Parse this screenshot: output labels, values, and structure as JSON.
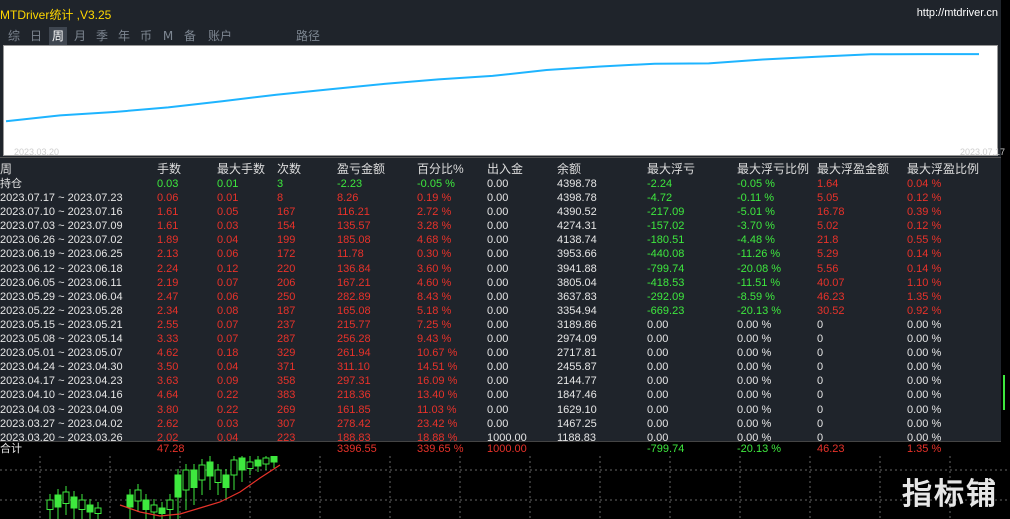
{
  "window": {
    "title": "MTDriver统计 ,V3.25",
    "site": "http://mtdriver.cn"
  },
  "tabs": [
    "综",
    "日",
    "周",
    "月",
    "季",
    "年",
    "币",
    "M",
    "备",
    "账户",
    "路径"
  ],
  "active_tab": "周",
  "curve": {
    "start_date": "2023.03.20",
    "end_date": "2023.07.17",
    "line_color": "#1eb4ff",
    "balances": [
      1188.83,
      1467.25,
      1629.1,
      1847.46,
      2144.77,
      2455.87,
      2717.81,
      2974.09,
      3189.86,
      3354.94,
      3637.83,
      3805.04,
      3941.88,
      3953.66,
      4138.74,
      4274.31,
      4390.52,
      4398.78,
      4398.78
    ]
  },
  "columns": [
    "周",
    "手数",
    "最大手数",
    "次数",
    "盈亏金额",
    "百分比%",
    "出入金",
    "余额",
    "最大浮亏",
    "最大浮亏比例",
    "最大浮盈金额",
    "最大浮盈比例"
  ],
  "holding": {
    "label": "持仓",
    "lots": "0.03",
    "max_lots": "0.01",
    "count": "3",
    "pnl": "-2.23",
    "pct": "-0.05 %",
    "deposit": "0.00",
    "balance": "4398.78",
    "max_dd": "-2.24",
    "max_dd_pct": "-0.05 %",
    "max_fp": "1.64",
    "max_fp_pct": "0.04 %"
  },
  "rows": [
    {
      "week": "2023.07.17 ~ 2023.07.23",
      "lots": "0.06",
      "max_lots": "0.01",
      "count": "8",
      "pnl": "8.26",
      "pct": "0.19 %",
      "deposit": "0.00",
      "balance": "4398.78",
      "max_dd": "-4.72",
      "max_dd_pct": "-0.11 %",
      "max_fp": "5.05",
      "max_fp_pct": "0.12 %"
    },
    {
      "week": "2023.07.10 ~ 2023.07.16",
      "lots": "1.61",
      "max_lots": "0.05",
      "count": "167",
      "pnl": "116.21",
      "pct": "2.72 %",
      "deposit": "0.00",
      "balance": "4390.52",
      "max_dd": "-217.09",
      "max_dd_pct": "-5.01 %",
      "max_fp": "16.78",
      "max_fp_pct": "0.39 %"
    },
    {
      "week": "2023.07.03 ~ 2023.07.09",
      "lots": "1.61",
      "max_lots": "0.03",
      "count": "154",
      "pnl": "135.57",
      "pct": "3.28 %",
      "deposit": "0.00",
      "balance": "4274.31",
      "max_dd": "-157.02",
      "max_dd_pct": "-3.70 %",
      "max_fp": "5.02",
      "max_fp_pct": "0.12 %"
    },
    {
      "week": "2023.06.26 ~ 2023.07.02",
      "lots": "1.89",
      "max_lots": "0.04",
      "count": "199",
      "pnl": "185.08",
      "pct": "4.68 %",
      "deposit": "0.00",
      "balance": "4138.74",
      "max_dd": "-180.51",
      "max_dd_pct": "-4.48 %",
      "max_fp": "21.8",
      "max_fp_pct": "0.55 %"
    },
    {
      "week": "2023.06.19 ~ 2023.06.25",
      "lots": "2.13",
      "max_lots": "0.06",
      "count": "172",
      "pnl": "11.78",
      "pct": "0.30 %",
      "deposit": "0.00",
      "balance": "3953.66",
      "max_dd": "-440.08",
      "max_dd_pct": "-11.26 %",
      "max_fp": "5.29",
      "max_fp_pct": "0.14 %"
    },
    {
      "week": "2023.06.12 ~ 2023.06.18",
      "lots": "2.24",
      "max_lots": "0.12",
      "count": "220",
      "pnl": "136.84",
      "pct": "3.60 %",
      "deposit": "0.00",
      "balance": "3941.88",
      "max_dd": "-799.74",
      "max_dd_pct": "-20.08 %",
      "max_fp": "5.56",
      "max_fp_pct": "0.14 %"
    },
    {
      "week": "2023.06.05 ~ 2023.06.11",
      "lots": "2.19",
      "max_lots": "0.07",
      "count": "206",
      "pnl": "167.21",
      "pct": "4.60 %",
      "deposit": "0.00",
      "balance": "3805.04",
      "max_dd": "-418.53",
      "max_dd_pct": "-11.51 %",
      "max_fp": "40.07",
      "max_fp_pct": "1.10 %"
    },
    {
      "week": "2023.05.29 ~ 2023.06.04",
      "lots": "2.47",
      "max_lots": "0.06",
      "count": "250",
      "pnl": "282.89",
      "pct": "8.43 %",
      "deposit": "0.00",
      "balance": "3637.83",
      "max_dd": "-292.09",
      "max_dd_pct": "-8.59 %",
      "max_fp": "46.23",
      "max_fp_pct": "1.35 %"
    },
    {
      "week": "2023.05.22 ~ 2023.05.28",
      "lots": "2.34",
      "max_lots": "0.08",
      "count": "187",
      "pnl": "165.08",
      "pct": "5.18 %",
      "deposit": "0.00",
      "balance": "3354.94",
      "max_dd": "-669.23",
      "max_dd_pct": "-20.13 %",
      "max_fp": "30.52",
      "max_fp_pct": "0.92 %"
    },
    {
      "week": "2023.05.15 ~ 2023.05.21",
      "lots": "2.55",
      "max_lots": "0.07",
      "count": "237",
      "pnl": "215.77",
      "pct": "7.25 %",
      "deposit": "0.00",
      "balance": "3189.86",
      "max_dd": "0.00",
      "max_dd_pct": "0.00 %",
      "max_fp": "0",
      "max_fp_pct": "0.00 %"
    },
    {
      "week": "2023.05.08 ~ 2023.05.14",
      "lots": "3.33",
      "max_lots": "0.07",
      "count": "287",
      "pnl": "256.28",
      "pct": "9.43 %",
      "deposit": "0.00",
      "balance": "2974.09",
      "max_dd": "0.00",
      "max_dd_pct": "0.00 %",
      "max_fp": "0",
      "max_fp_pct": "0.00 %"
    },
    {
      "week": "2023.05.01 ~ 2023.05.07",
      "lots": "4.62",
      "max_lots": "0.18",
      "count": "329",
      "pnl": "261.94",
      "pct": "10.67 %",
      "deposit": "0.00",
      "balance": "2717.81",
      "max_dd": "0.00",
      "max_dd_pct": "0.00 %",
      "max_fp": "0",
      "max_fp_pct": "0.00 %"
    },
    {
      "week": "2023.04.24 ~ 2023.04.30",
      "lots": "3.50",
      "max_lots": "0.04",
      "count": "371",
      "pnl": "311.10",
      "pct": "14.51 %",
      "deposit": "0.00",
      "balance": "2455.87",
      "max_dd": "0.00",
      "max_dd_pct": "0.00 %",
      "max_fp": "0",
      "max_fp_pct": "0.00 %"
    },
    {
      "week": "2023.04.17 ~ 2023.04.23",
      "lots": "3.63",
      "max_lots": "0.09",
      "count": "358",
      "pnl": "297.31",
      "pct": "16.09 %",
      "deposit": "0.00",
      "balance": "2144.77",
      "max_dd": "0.00",
      "max_dd_pct": "0.00 %",
      "max_fp": "0",
      "max_fp_pct": "0.00 %"
    },
    {
      "week": "2023.04.10 ~ 2023.04.16",
      "lots": "4.64",
      "max_lots": "0.22",
      "count": "383",
      "pnl": "218.36",
      "pct": "13.40 %",
      "deposit": "0.00",
      "balance": "1847.46",
      "max_dd": "0.00",
      "max_dd_pct": "0.00 %",
      "max_fp": "0",
      "max_fp_pct": "0.00 %"
    },
    {
      "week": "2023.04.03 ~ 2023.04.09",
      "lots": "3.80",
      "max_lots": "0.22",
      "count": "269",
      "pnl": "161.85",
      "pct": "11.03 %",
      "deposit": "0.00",
      "balance": "1629.10",
      "max_dd": "0.00",
      "max_dd_pct": "0.00 %",
      "max_fp": "0",
      "max_fp_pct": "0.00 %"
    },
    {
      "week": "2023.03.27 ~ 2023.04.02",
      "lots": "2.62",
      "max_lots": "0.03",
      "count": "307",
      "pnl": "278.42",
      "pct": "23.42 %",
      "deposit": "0.00",
      "balance": "1467.25",
      "max_dd": "0.00",
      "max_dd_pct": "0.00 %",
      "max_fp": "0",
      "max_fp_pct": "0.00 %"
    },
    {
      "week": "2023.03.20 ~ 2023.03.26",
      "lots": "2.02",
      "max_lots": "0.04",
      "count": "223",
      "pnl": "188.83",
      "pct": "18.88 %",
      "deposit": "1000.00",
      "balance": "1188.83",
      "max_dd": "0.00",
      "max_dd_pct": "0.00 %",
      "max_fp": "0",
      "max_fp_pct": "0.00 %"
    }
  ],
  "total": {
    "label": "合计",
    "lots": "47.28",
    "pnl": "3396.55",
    "pct": "339.65 %",
    "deposit": "1000.00",
    "max_dd": "-799.74",
    "max_dd_pct": "-20.13 %",
    "max_fp": "46.23",
    "max_fp_pct": "1.35 %"
  },
  "watermark": "指标铺"
}
